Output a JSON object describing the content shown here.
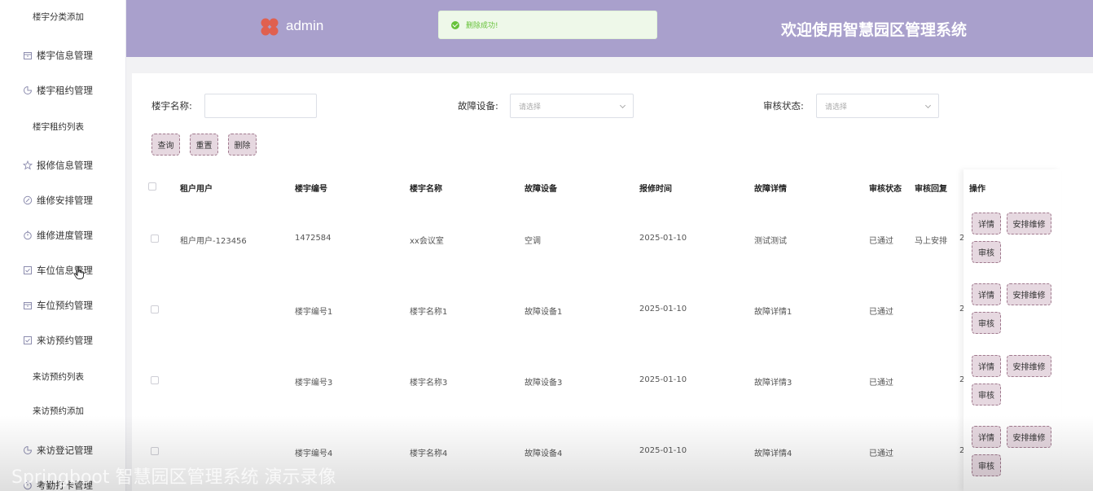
{
  "sidebar": {
    "items": [
      {
        "label": "楼宇分类添加",
        "icon": "none",
        "level": "sub"
      },
      {
        "label": "楼宇信息管理",
        "icon": "box-icon",
        "level": "top"
      },
      {
        "label": "楼宇租约管理",
        "icon": "pie-icon",
        "level": "top"
      },
      {
        "label": "楼宇租约列表",
        "icon": "none",
        "level": "sub"
      },
      {
        "label": "报修信息管理",
        "icon": "star-icon",
        "level": "top"
      },
      {
        "label": "维修安排管理",
        "icon": "compass-icon",
        "level": "top"
      },
      {
        "label": "维修进度管理",
        "icon": "timer-icon",
        "level": "top"
      },
      {
        "label": "车位信息管理",
        "icon": "check-square-icon",
        "level": "top"
      },
      {
        "label": "车位预约管理",
        "icon": "box-icon",
        "level": "top"
      },
      {
        "label": "来访预约管理",
        "icon": "check-square-icon",
        "level": "top"
      },
      {
        "label": "来访预约列表",
        "icon": "none",
        "level": "sub"
      },
      {
        "label": "来访预约添加",
        "icon": "none",
        "level": "sub"
      },
      {
        "label": "来访登记管理",
        "icon": "pie-icon",
        "level": "top"
      },
      {
        "label": "考勤打卡管理",
        "icon": "timer-icon",
        "level": "top"
      }
    ]
  },
  "header": {
    "admin": "admin",
    "title": "欢迎使用智慧园区管理系统",
    "toast": "删除成功!",
    "background": "#a9a0cc"
  },
  "search": {
    "name_label": "楼宇名称:",
    "name_value": "",
    "device_label": "故障设备:",
    "device_placeholder": "请选择",
    "status_label": "审核状态:",
    "status_placeholder": "请选择",
    "query": "查询",
    "reset": "重置",
    "delete": "删除"
  },
  "table": {
    "headers": [
      "租户用户",
      "楼宇编号",
      "楼宇名称",
      "故障设备",
      "报修时间",
      "故障详情",
      "审核状态",
      "审核回复",
      "操作"
    ],
    "rows": [
      {
        "user": "租户用户-123456",
        "code": "1472584",
        "name": "xx会议室",
        "device": "空调",
        "time": "2025-01-10",
        "detail": "测试测试",
        "status": "已通过",
        "reply": "马上安排",
        "extra": "2"
      },
      {
        "user": "",
        "code": "楼宇编号1",
        "name": "楼宇名称1",
        "device": "故障设备1",
        "time": "2025-01-10",
        "detail": "故障详情1",
        "status": "已通过",
        "reply": "",
        "extra": "2"
      },
      {
        "user": "",
        "code": "楼宇编号3",
        "name": "楼宇名称3",
        "device": "故障设备3",
        "time": "2025-01-10",
        "detail": "故障详情3",
        "status": "已通过",
        "reply": "",
        "extra": "2"
      },
      {
        "user": "",
        "code": "楼宇编号4",
        "name": "楼宇名称4",
        "device": "故障设备4",
        "time": "2025-01-10",
        "detail": "故障详情4",
        "status": "已通过",
        "reply": "",
        "extra": "2"
      }
    ],
    "ops": {
      "detail": "详情",
      "arrange": "安排维修",
      "audit": "审核"
    }
  },
  "watermark": "Springboot 智慧园区管理系统 演示录像"
}
